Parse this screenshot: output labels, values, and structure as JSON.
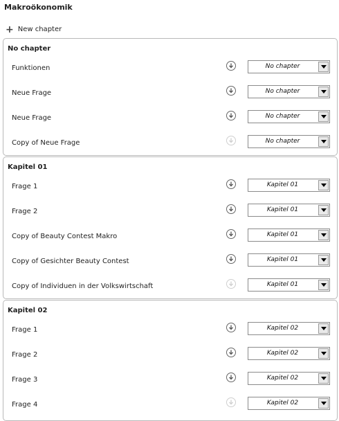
{
  "page": {
    "title": "Makroökonomik",
    "new_chapter_label": "New chapter"
  },
  "chapters": [
    {
      "title": "No chapter",
      "rows": [
        {
          "label": "Funktionen",
          "icon_enabled": true,
          "chapter": "No chapter"
        },
        {
          "label": "Neue Frage",
          "icon_enabled": true,
          "chapter": "No chapter"
        },
        {
          "label": "Neue Frage",
          "icon_enabled": true,
          "chapter": "No chapter"
        },
        {
          "label": "Copy of Neue Frage",
          "icon_enabled": false,
          "chapter": "No chapter"
        }
      ]
    },
    {
      "title": "Kapitel 01",
      "rows": [
        {
          "label": "Frage 1",
          "icon_enabled": true,
          "chapter": "Kapitel 01"
        },
        {
          "label": "Frage 2",
          "icon_enabled": true,
          "chapter": "Kapitel 01"
        },
        {
          "label": "Copy of Beauty Contest Makro",
          "icon_enabled": true,
          "chapter": "Kapitel 01"
        },
        {
          "label": "Copy of Gesichter Beauty Contest",
          "icon_enabled": true,
          "chapter": "Kapitel 01"
        },
        {
          "label": "Copy of Individuen in der Volkswirtschaft",
          "icon_enabled": false,
          "chapter": "Kapitel 01"
        }
      ]
    },
    {
      "title": "Kapitel 02",
      "rows": [
        {
          "label": "Frage 1",
          "icon_enabled": true,
          "chapter": "Kapitel 02"
        },
        {
          "label": "Frage 2",
          "icon_enabled": true,
          "chapter": "Kapitel 02"
        },
        {
          "label": "Frage 3",
          "icon_enabled": true,
          "chapter": "Kapitel 02"
        },
        {
          "label": "Frage 4",
          "icon_enabled": false,
          "chapter": "Kapitel 02"
        }
      ]
    }
  ]
}
